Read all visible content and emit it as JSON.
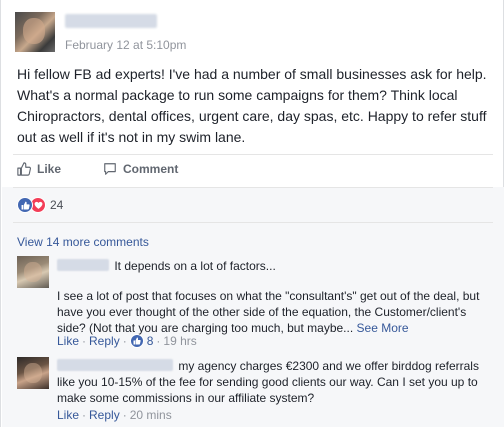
{
  "post": {
    "timestamp": "February 12 at 5:10pm",
    "text": "Hi fellow FB ad experts! I've had a number of small businesses ask for help. What's a normal package to run some campaigns for them? Think local Chiropractors, dental offices, urgent care, day spas, etc. Happy to refer stuff out as well if it's not in my swim lane."
  },
  "actions": {
    "like_label": "Like",
    "comment_label": "Comment"
  },
  "reactions": {
    "count": "24"
  },
  "comments_section": {
    "view_more": "View 14 more comments"
  },
  "comments": [
    {
      "line1": "It depends on a lot of factors...",
      "line2": "I see a lot of post that focuses on what the \"consultant's\" get out of the deal, but have you ever thought of the other side of the equation, the Customer/client's side? (Not that you are charging too much, but maybe...",
      "see_more": "See More",
      "like": "Like",
      "reply": "Reply",
      "likes_count": "8",
      "time": "19 hrs"
    },
    {
      "text": "my agency charges €2300 and we offer birddog referrals like you 10-15% of the fee for sending good clients our way. Can I set you up to make some commissions in our affiliate system?",
      "like": "Like",
      "reply": "Reply",
      "time": "20 mins"
    }
  ],
  "colors": {
    "link": "#365899",
    "like_blue": "#4267b2",
    "love_red": "#f33e58",
    "meta_gray": "#90949c",
    "comments_bg": "#f6f7f9"
  }
}
